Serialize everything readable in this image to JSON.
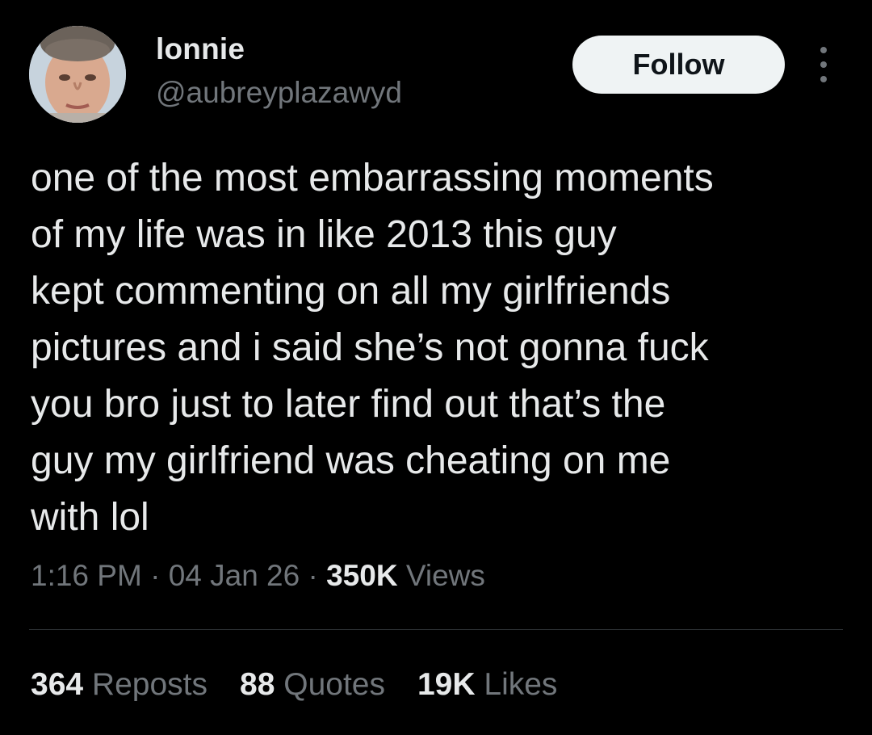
{
  "author": {
    "display_name": "lonnie",
    "handle": "@aubreyplazawyd"
  },
  "header": {
    "follow_label": "Follow"
  },
  "tweet": {
    "text": "one of the most embarrassing moments\nof my life was in like 2013 this guy\nkept commenting on all my girlfriends\npictures and i said she’s not gonna fuck\nyou bro just to later find out that’s the\nguy my girlfriend was cheating on me\nwith lol",
    "time": "1:16 PM",
    "date": "04 Jan 26",
    "separator": "·",
    "views_count": "350K",
    "views_label": "Views"
  },
  "stats": {
    "reposts_count": "364",
    "reposts_label": "Reposts",
    "quotes_count": "88",
    "quotes_label": "Quotes",
    "likes_count": "19K",
    "likes_label": "Likes"
  },
  "colors": {
    "background": "#000000",
    "primary_text": "#e7e9ea",
    "secondary_text": "#71767b",
    "follow_button_bg": "#eff3f4",
    "divider": "#2f3336"
  },
  "icons": {
    "more": "more-horizontal-icon"
  }
}
